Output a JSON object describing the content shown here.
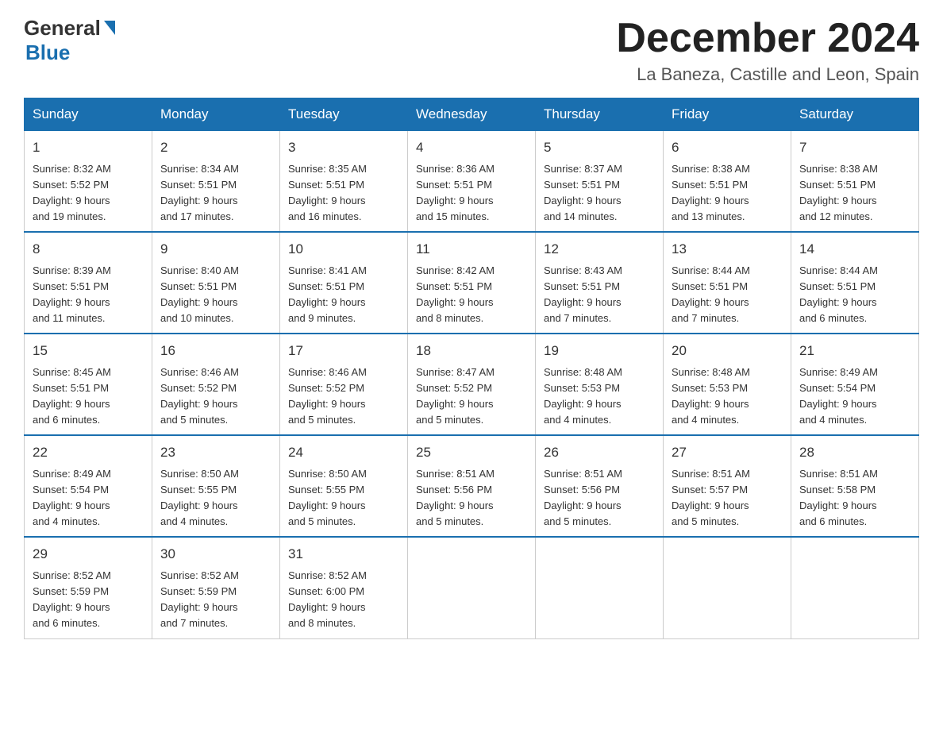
{
  "logo": {
    "general": "General",
    "blue": "Blue"
  },
  "title": "December 2024",
  "subtitle": "La Baneza, Castille and Leon, Spain",
  "headers": [
    "Sunday",
    "Monday",
    "Tuesday",
    "Wednesday",
    "Thursday",
    "Friday",
    "Saturday"
  ],
  "weeks": [
    [
      {
        "day": "1",
        "sunrise": "8:32 AM",
        "sunset": "5:52 PM",
        "daylight": "9 hours and 19 minutes."
      },
      {
        "day": "2",
        "sunrise": "8:34 AM",
        "sunset": "5:51 PM",
        "daylight": "9 hours and 17 minutes."
      },
      {
        "day": "3",
        "sunrise": "8:35 AM",
        "sunset": "5:51 PM",
        "daylight": "9 hours and 16 minutes."
      },
      {
        "day": "4",
        "sunrise": "8:36 AM",
        "sunset": "5:51 PM",
        "daylight": "9 hours and 15 minutes."
      },
      {
        "day": "5",
        "sunrise": "8:37 AM",
        "sunset": "5:51 PM",
        "daylight": "9 hours and 14 minutes."
      },
      {
        "day": "6",
        "sunrise": "8:38 AM",
        "sunset": "5:51 PM",
        "daylight": "9 hours and 13 minutes."
      },
      {
        "day": "7",
        "sunrise": "8:38 AM",
        "sunset": "5:51 PM",
        "daylight": "9 hours and 12 minutes."
      }
    ],
    [
      {
        "day": "8",
        "sunrise": "8:39 AM",
        "sunset": "5:51 PM",
        "daylight": "9 hours and 11 minutes."
      },
      {
        "day": "9",
        "sunrise": "8:40 AM",
        "sunset": "5:51 PM",
        "daylight": "9 hours and 10 minutes."
      },
      {
        "day": "10",
        "sunrise": "8:41 AM",
        "sunset": "5:51 PM",
        "daylight": "9 hours and 9 minutes."
      },
      {
        "day": "11",
        "sunrise": "8:42 AM",
        "sunset": "5:51 PM",
        "daylight": "9 hours and 8 minutes."
      },
      {
        "day": "12",
        "sunrise": "8:43 AM",
        "sunset": "5:51 PM",
        "daylight": "9 hours and 7 minutes."
      },
      {
        "day": "13",
        "sunrise": "8:44 AM",
        "sunset": "5:51 PM",
        "daylight": "9 hours and 7 minutes."
      },
      {
        "day": "14",
        "sunrise": "8:44 AM",
        "sunset": "5:51 PM",
        "daylight": "9 hours and 6 minutes."
      }
    ],
    [
      {
        "day": "15",
        "sunrise": "8:45 AM",
        "sunset": "5:51 PM",
        "daylight": "9 hours and 6 minutes."
      },
      {
        "day": "16",
        "sunrise": "8:46 AM",
        "sunset": "5:52 PM",
        "daylight": "9 hours and 5 minutes."
      },
      {
        "day": "17",
        "sunrise": "8:46 AM",
        "sunset": "5:52 PM",
        "daylight": "9 hours and 5 minutes."
      },
      {
        "day": "18",
        "sunrise": "8:47 AM",
        "sunset": "5:52 PM",
        "daylight": "9 hours and 5 minutes."
      },
      {
        "day": "19",
        "sunrise": "8:48 AM",
        "sunset": "5:53 PM",
        "daylight": "9 hours and 4 minutes."
      },
      {
        "day": "20",
        "sunrise": "8:48 AM",
        "sunset": "5:53 PM",
        "daylight": "9 hours and 4 minutes."
      },
      {
        "day": "21",
        "sunrise": "8:49 AM",
        "sunset": "5:54 PM",
        "daylight": "9 hours and 4 minutes."
      }
    ],
    [
      {
        "day": "22",
        "sunrise": "8:49 AM",
        "sunset": "5:54 PM",
        "daylight": "9 hours and 4 minutes."
      },
      {
        "day": "23",
        "sunrise": "8:50 AM",
        "sunset": "5:55 PM",
        "daylight": "9 hours and 4 minutes."
      },
      {
        "day": "24",
        "sunrise": "8:50 AM",
        "sunset": "5:55 PM",
        "daylight": "9 hours and 5 minutes."
      },
      {
        "day": "25",
        "sunrise": "8:51 AM",
        "sunset": "5:56 PM",
        "daylight": "9 hours and 5 minutes."
      },
      {
        "day": "26",
        "sunrise": "8:51 AM",
        "sunset": "5:56 PM",
        "daylight": "9 hours and 5 minutes."
      },
      {
        "day": "27",
        "sunrise": "8:51 AM",
        "sunset": "5:57 PM",
        "daylight": "9 hours and 5 minutes."
      },
      {
        "day": "28",
        "sunrise": "8:51 AM",
        "sunset": "5:58 PM",
        "daylight": "9 hours and 6 minutes."
      }
    ],
    [
      {
        "day": "29",
        "sunrise": "8:52 AM",
        "sunset": "5:59 PM",
        "daylight": "9 hours and 6 minutes."
      },
      {
        "day": "30",
        "sunrise": "8:52 AM",
        "sunset": "5:59 PM",
        "daylight": "9 hours and 7 minutes."
      },
      {
        "day": "31",
        "sunrise": "8:52 AM",
        "sunset": "6:00 PM",
        "daylight": "9 hours and 8 minutes."
      },
      null,
      null,
      null,
      null
    ]
  ],
  "labels": {
    "sunrise": "Sunrise:",
    "sunset": "Sunset:",
    "daylight": "Daylight:"
  }
}
